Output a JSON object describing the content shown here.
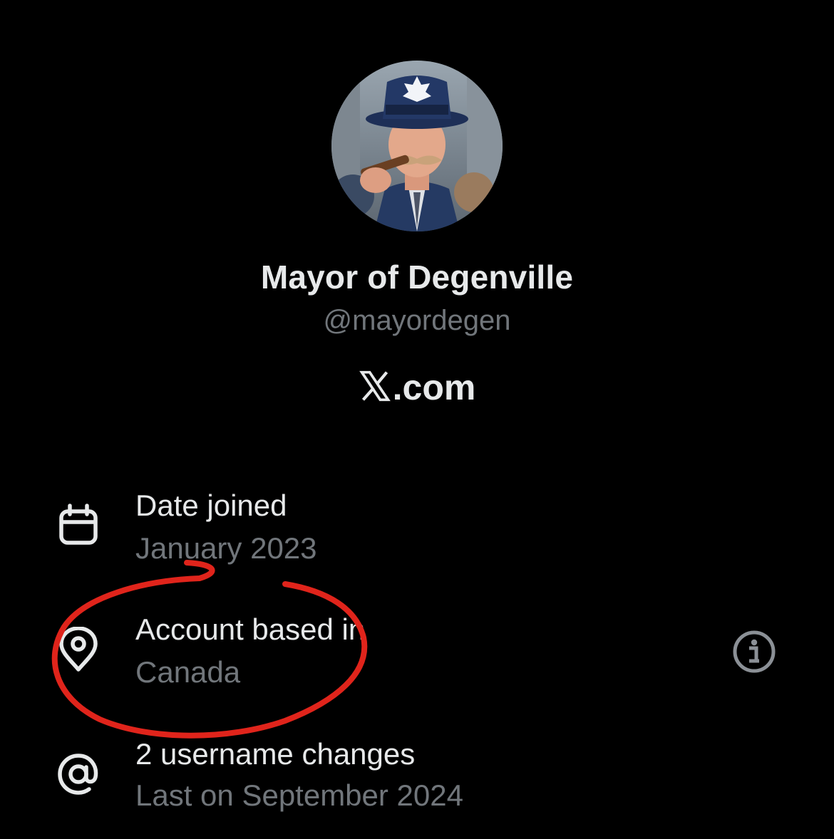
{
  "profile": {
    "display_name": "Mayor of Degenville",
    "handle": "@mayordegen",
    "avatar_icon": "profile-photo"
  },
  "site": {
    "logo_suffix": ".com",
    "logo_icon": "x-logo-icon"
  },
  "details": [
    {
      "icon": "calendar-icon",
      "title": "Date joined",
      "value": "January 2023"
    },
    {
      "icon": "location-pin-icon",
      "title": "Account based in",
      "value": "Canada",
      "trailing_icon": "info-icon"
    },
    {
      "icon": "at-sign-icon",
      "title": "2 username changes",
      "value": "Last on September 2024"
    }
  ],
  "colors": {
    "background": "#000000",
    "primary_text": "#e7e9ea",
    "secondary_text": "#71767b",
    "annotation": "#e0241b"
  }
}
